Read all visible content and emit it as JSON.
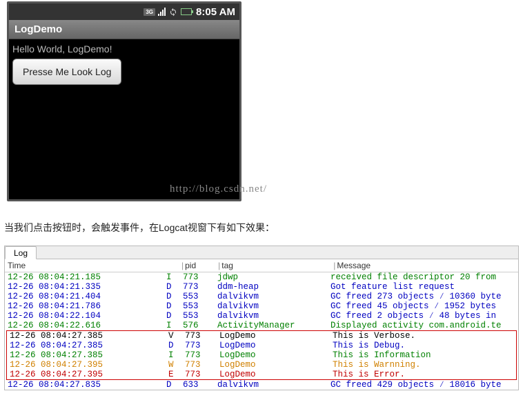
{
  "phone": {
    "status": {
      "net": "3G",
      "time": "8:05 AM"
    },
    "title": "LogDemo",
    "hello": "Hello World, LogDemo!",
    "button": "Presse Me Look Log",
    "watermark": "http://blog.csdn.net/"
  },
  "description": "当我们点击按钮时，会触发事件，在Logcat视窗下有如下效果：",
  "logcat": {
    "tab": "Log",
    "headers": {
      "time": "Time",
      "pid": "pid",
      "tag": "tag",
      "msg": "Message"
    },
    "rows_top": [
      {
        "time": "12-26 08:04:21.185",
        "lvl": "I",
        "pid": "773",
        "tag": "jdwp",
        "msg": "received file descriptor 20 from"
      },
      {
        "time": "12-26 08:04:21.335",
        "lvl": "D",
        "pid": "773",
        "tag": "ddm-heap",
        "msg": "Got feature list request"
      },
      {
        "time": "12-26 08:04:21.404",
        "lvl": "D",
        "pid": "553",
        "tag": "dalvikvm",
        "msg": "GC freed 273 objects ∕ 10360 byte"
      },
      {
        "time": "12-26 08:04:21.786",
        "lvl": "D",
        "pid": "553",
        "tag": "dalvikvm",
        "msg": "GC freed 45 objects ∕ 1952 bytes"
      },
      {
        "time": "12-26 08:04:22.104",
        "lvl": "D",
        "pid": "553",
        "tag": "dalvikvm",
        "msg": "GC freed 2 objects ∕ 48 bytes in"
      },
      {
        "time": "12-26 08:04:22.616",
        "lvl": "I",
        "pid": "576",
        "tag": "ActivityManager",
        "msg": "Displayed activity com.android.te"
      }
    ],
    "rows_box": [
      {
        "time": "12-26 08:04:27.385",
        "lvl": "V",
        "pid": "773",
        "tag": "LogDemo",
        "msg": "This is Verbose."
      },
      {
        "time": "12-26 08:04:27.385",
        "lvl": "D",
        "pid": "773",
        "tag": "LogDemo",
        "msg": "This is Debug."
      },
      {
        "time": "12-26 08:04:27.385",
        "lvl": "I",
        "pid": "773",
        "tag": "LogDemo",
        "msg": "This is Information"
      },
      {
        "time": "12-26 08:04:27.395",
        "lvl": "W",
        "pid": "773",
        "tag": "LogDemo",
        "msg": "This is Warnning."
      },
      {
        "time": "12-26 08:04:27.395",
        "lvl": "E",
        "pid": "773",
        "tag": "LogDemo",
        "msg": "This is Error."
      }
    ],
    "rows_bottom": [
      {
        "time": "12-26 08:04:27.835",
        "lvl": "D",
        "pid": "633",
        "tag": "dalvikvm",
        "msg": "GC freed 429 objects ∕ 18016 byte"
      }
    ]
  }
}
